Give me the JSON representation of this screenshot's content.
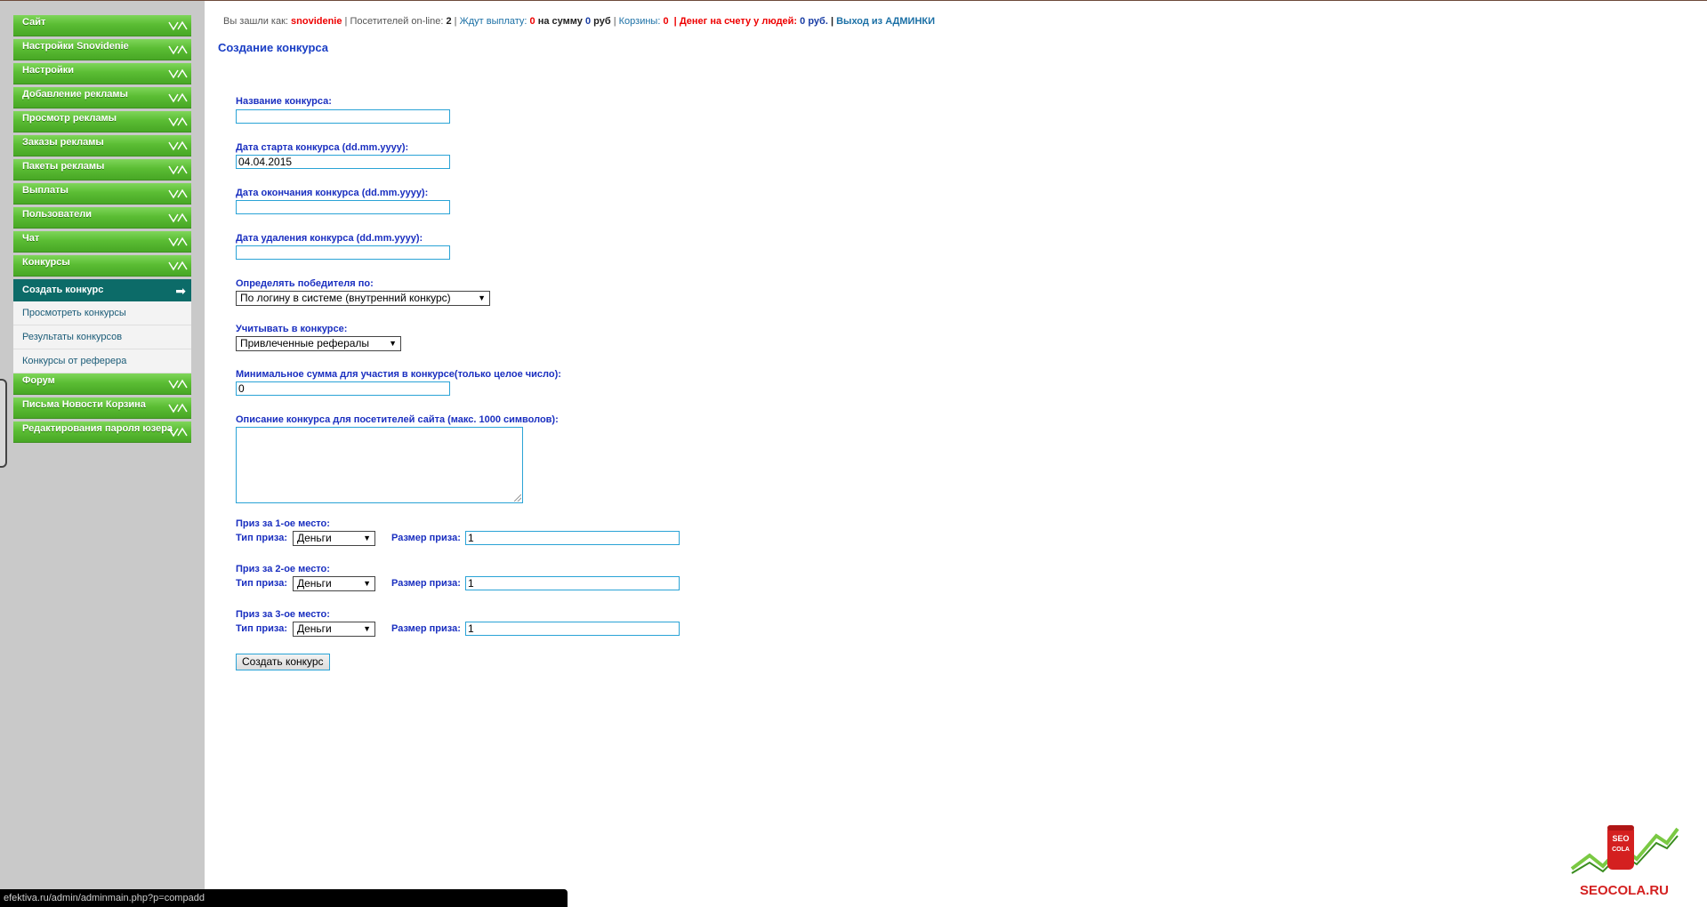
{
  "sidebar": {
    "items_top": [
      {
        "label": "Сайт"
      },
      {
        "label": "Настройки Snovidenie"
      },
      {
        "label": "Настройки"
      },
      {
        "label": "Добавление рекламы"
      },
      {
        "label": "Просмотр рекламы"
      },
      {
        "label": "Заказы рекламы"
      },
      {
        "label": "Пакеты рекламы"
      },
      {
        "label": "Выплаты"
      },
      {
        "label": "Пользователи"
      },
      {
        "label": "Чат"
      },
      {
        "label": "Конкурсы"
      }
    ],
    "active_sub": {
      "label": "Создать конкурс"
    },
    "subs": [
      {
        "label": "Просмотреть конкурсы"
      },
      {
        "label": "Результаты конкурсов"
      },
      {
        "label": "Конкурсы от реферера"
      }
    ],
    "items_bottom": [
      {
        "label": "Форум"
      },
      {
        "label": "Письма Новости Корзина"
      },
      {
        "label": "Редактирования пароля юзера"
      }
    ]
  },
  "info": {
    "logged_as_label": "Вы зашли как:",
    "username": "snovidenie",
    "online_label": "Посетителей on-line:",
    "online_count": "2",
    "await_label": "Ждут выплату:",
    "await_count": "0",
    "sum_label": "на сумму",
    "sum_value": "0",
    "currency": "руб",
    "carts_label": "Корзины:",
    "carts_count": "0",
    "money_label": "Денег на счету у людей:",
    "money_value": "0",
    "money_currency": "руб.",
    "exit_label": "Выход из АДМИНКИ"
  },
  "page_title": "Создание конкурса",
  "form": {
    "name_label": "Название конкурса:",
    "name_value": "",
    "start_label": "Дата старта конкурса (dd.mm.yyyy):",
    "start_value": "04.04.2015",
    "end_label": "Дата окончания конкурса (dd.mm.yyyy):",
    "end_value": "",
    "delete_label": "Дата удаления конкурса (dd.mm.yyyy):",
    "delete_value": "",
    "winner_label": "Определять победителя по:",
    "winner_value": "По логину в системе (внутренний конкурс)",
    "count_label": "Учитывать в конкурсе:",
    "count_value": "Привлеченные рефералы",
    "min_label": "Минимальное сумма для участия в конкурсе(только целое число):",
    "min_value": "0",
    "desc_label": "Описание конкурса для посетителей сайта (макс. 1000 символов):",
    "prizes": [
      {
        "title": "Приз за 1-ое место:",
        "type_label": "Тип приза:",
        "type_value": "Деньги",
        "size_label": "Размер приза:",
        "size_value": "1"
      },
      {
        "title": "Приз за 2-ое место:",
        "type_label": "Тип приза:",
        "type_value": "Деньги",
        "size_label": "Размер приза:",
        "size_value": "1"
      },
      {
        "title": "Приз за 3-ое место:",
        "type_label": "Тип приза:",
        "type_value": "Деньги",
        "size_label": "Размер приза:",
        "size_value": "1"
      }
    ],
    "submit_label": "Создать конкурс"
  },
  "status_url": "efektiva.ru/admin/adminmain.php?p=compadd",
  "logo": {
    "can_text_1": "SEO",
    "can_text_2": "COLA",
    "site_text": "SEOCOLA.RU"
  },
  "colors": {
    "menu_green": "#5bbd34",
    "active_teal": "#0c6b68",
    "label_blue": "#1a2fc0"
  }
}
